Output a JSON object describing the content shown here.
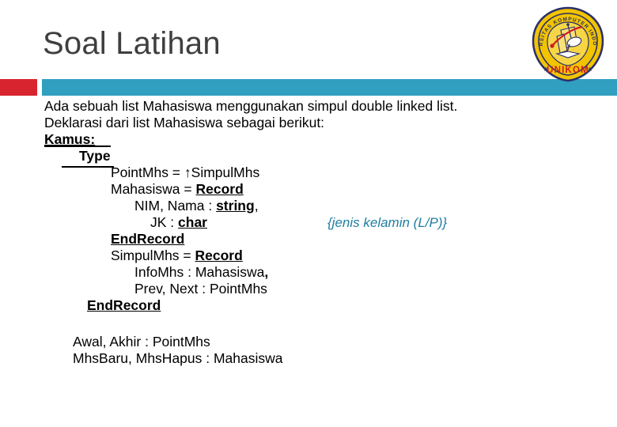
{
  "slide": {
    "title": "Soal Latihan",
    "accent_red": "#d8242f",
    "accent_teal": "#309fc0",
    "title_color": "#3f3f3f",
    "comment_color": "#1f7fa0"
  },
  "logo": {
    "name": "unikom-logo",
    "ring_text": "UNIVERSITAS KOMPUTER INDONESIA",
    "wordmark": "UNIKOM",
    "shield_color": "#f2c400",
    "ring_color": "#2a2f6b",
    "wordmark_color": "#cf1b24"
  },
  "body": {
    "intro_line_1": "Ada sebuah list Mahasiswa menggunakan simpul double linked list.",
    "intro_line_2": "Deklarasi dari list Mahasiswa sebagai berikut:",
    "kamus_label": "Kamus:",
    "type_label": "Type",
    "lines": {
      "point_mhs": "PointMhs = ↑SimpulMhs",
      "mahasiswa_decl_prefix": "Mahasiswa = ",
      "record_kw": "Record",
      "nim_nama_prefix": "NIM, Nama : ",
      "string_kw": "string",
      "nim_nama_suffix": ",",
      "jk_prefix": "JK : ",
      "char_kw": "char",
      "jk_comment": "{jenis kelamin (L/P)}",
      "end_record_1": "EndRecord",
      "simpul_decl_prefix": "SimpulMhs = ",
      "record_kw_2": "Record",
      "info_mhs": "InfoMhs : Mahasiswa",
      "info_mhs_comma": ",",
      "prev_next": "Prev, Next : PointMhs",
      "end_record_2": "EndRecord"
    },
    "vars": {
      "line_1": "Awal, Akhir : PointMhs",
      "line_2": "MhsBaru, MhsHapus : Mahasiswa"
    }
  }
}
